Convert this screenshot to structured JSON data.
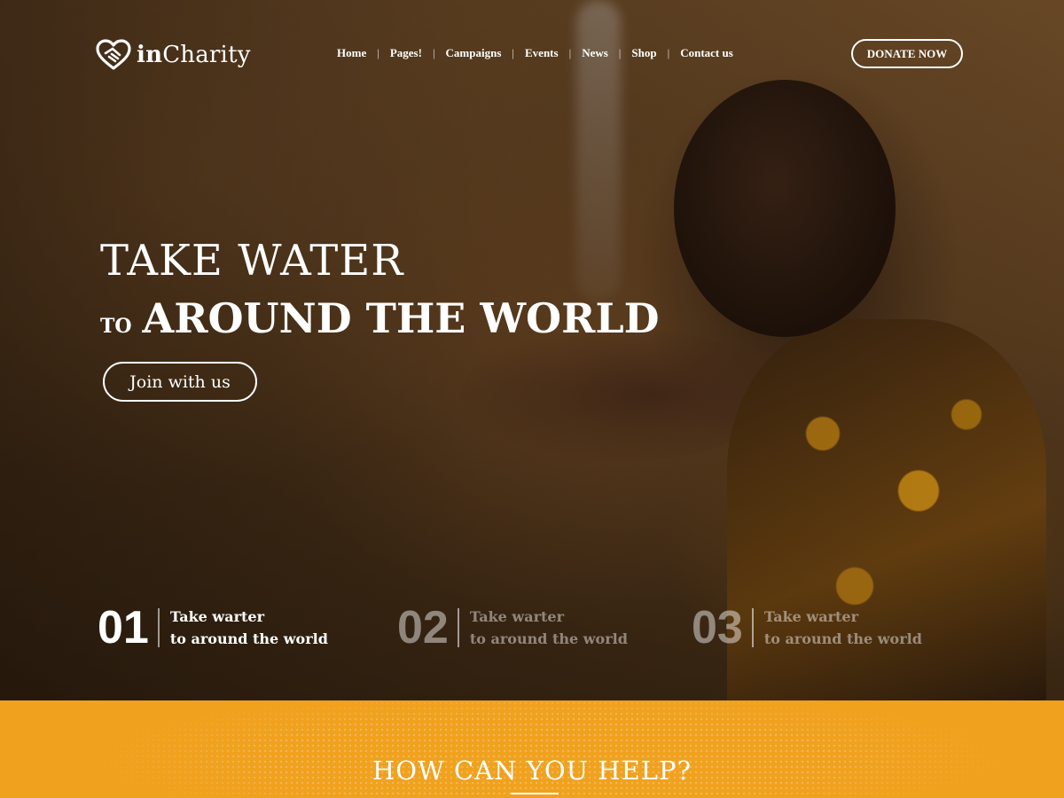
{
  "brand": {
    "name_bold": "in",
    "name_rest": "Charity"
  },
  "nav": {
    "items": [
      {
        "label": "Home"
      },
      {
        "label": "Pages!"
      },
      {
        "label": "Campaigns"
      },
      {
        "label": "Events"
      },
      {
        "label": "News"
      },
      {
        "label": "Shop"
      },
      {
        "label": "Contact us"
      }
    ],
    "separator": "|"
  },
  "donate_label": "DONATE NOW",
  "hero": {
    "line1": "TAKE WATER",
    "line2_small": "TO",
    "line2": "AROUND THE WORLD",
    "cta_label": "Join with us"
  },
  "steps": [
    {
      "num": "01",
      "line1": "Take warter",
      "line2": "to around the world",
      "active": true
    },
    {
      "num": "02",
      "line1": "Take warter",
      "line2": "to around the world",
      "active": false
    },
    {
      "num": "03",
      "line1": "Take warter",
      "line2": "to around the world",
      "active": false
    }
  ],
  "help_section": {
    "title": "HOW CAN YOU HELP?"
  },
  "colors": {
    "accent": "#f0a11e",
    "text": "#ffffff"
  },
  "icons": {
    "logo": "heart-handshake-icon"
  }
}
